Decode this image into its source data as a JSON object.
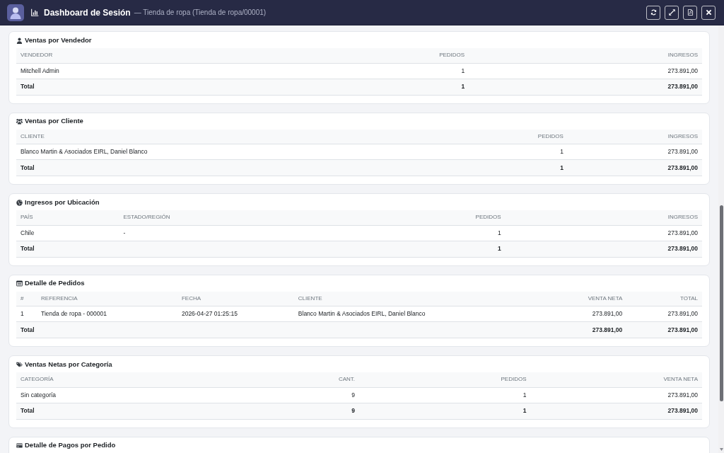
{
  "window": {
    "title": "Dashboard de Sesión",
    "subtitle": "— Tienda de ropa (Tienda de ropa/00001)"
  },
  "sections": [
    {
      "kind": "seller",
      "title": "Ventas por Vendedor",
      "columns": [
        "VENDEDOR",
        "PEDIDOS",
        "INGRESOS"
      ],
      "rows": [
        [
          "Mitchell Admin",
          "1",
          "273.891,00"
        ]
      ],
      "total": [
        "Total",
        "1",
        "273.891,00"
      ]
    },
    {
      "kind": "customer",
      "title": "Ventas por Cliente",
      "columns": [
        "CLIENTE",
        "PEDIDOS",
        "INGRESOS"
      ],
      "rows": [
        [
          "Blanco Martin & Asociados EIRL, Daniel Blanco",
          "1",
          "273.891,00"
        ]
      ],
      "total": [
        "Total",
        "1",
        "273.891,00"
      ]
    },
    {
      "kind": "location",
      "title": "Ingresos por Ubicación",
      "columns": [
        "PAÍS",
        "ESTADO/REGIÓN",
        "PEDIDOS",
        "INGRESOS"
      ],
      "rows": [
        [
          "Chile",
          "-",
          "1",
          "273.891,00"
        ]
      ],
      "total": [
        "Total",
        "1",
        "273.891,00"
      ]
    },
    {
      "kind": "orders",
      "title": "Detalle de Pedidos",
      "columns": [
        "#",
        "REFERENCIA",
        "FECHA",
        "CLIENTE",
        "VENTA NETA",
        "TOTAL"
      ],
      "rows": [
        [
          "1",
          "Tienda de ropa - 000001",
          "2026-04-27 01:25:15",
          "Blanco Martin & Asociados EIRL, Daniel Blanco",
          "273.891,00",
          "273.891,00"
        ]
      ],
      "total": [
        "Total",
        "273.891,00",
        "273.891,00"
      ]
    },
    {
      "kind": "category",
      "title": "Ventas Netas por Categoría",
      "columns": [
        "CATEGORÍA",
        "CANT.",
        "PEDIDOS",
        "VENTA NETA"
      ],
      "rows": [
        [
          "Sin categoría",
          "9",
          "1",
          "273.891,00"
        ]
      ],
      "total": [
        "Total",
        "9",
        "1",
        "273.891,00"
      ]
    },
    {
      "kind": "payments",
      "title": "Detalle de Pagos por Pedido"
    }
  ]
}
